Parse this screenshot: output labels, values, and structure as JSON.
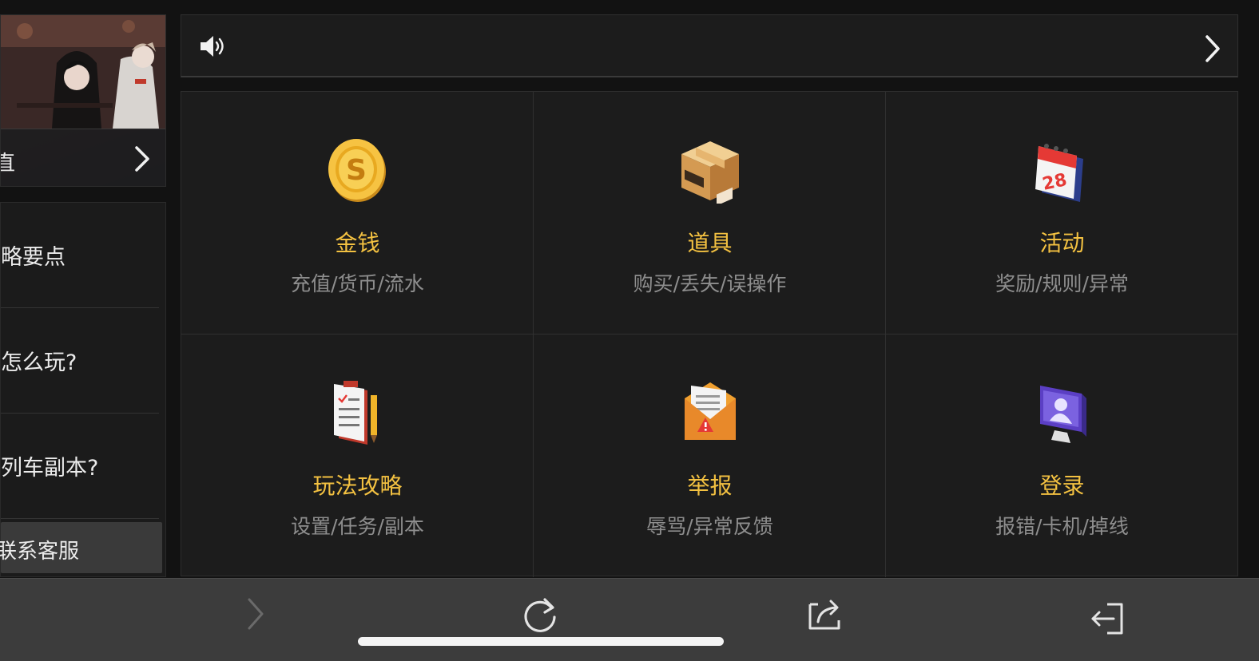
{
  "sidebar": {
    "banner_label": "直",
    "faq_items": [
      {
        "label": "略要点"
      },
      {
        "label": "怎么玩?"
      },
      {
        "label": "列车副本?"
      }
    ],
    "contact_label": "联系客服"
  },
  "notice": {
    "text": ""
  },
  "categories": [
    {
      "title": "金钱",
      "subtitle": "充值/货币/流水",
      "icon": "gold-coin-icon"
    },
    {
      "title": "道具",
      "subtitle": "购买/丢失/误操作",
      "icon": "package-box-icon"
    },
    {
      "title": "活动",
      "subtitle": "奖励/规则/异常",
      "icon": "calendar-icon"
    },
    {
      "title": "玩法攻略",
      "subtitle": "设置/任务/副本",
      "icon": "clipboard-icon"
    },
    {
      "title": "举报",
      "subtitle": "辱骂/异常反馈",
      "icon": "warning-envelope-icon"
    },
    {
      "title": "登录",
      "subtitle": "报错/卡机/掉线",
      "icon": "user-monitor-icon"
    }
  ],
  "toolbar": {
    "buttons": [
      "forward-icon",
      "reload-icon",
      "share-icon",
      "exit-icon"
    ]
  },
  "colors": {
    "accent": "#f3c141",
    "subtitle": "#8e8e8e",
    "panel": "#1c1c1c",
    "toolbar": "#3c3c3c"
  }
}
